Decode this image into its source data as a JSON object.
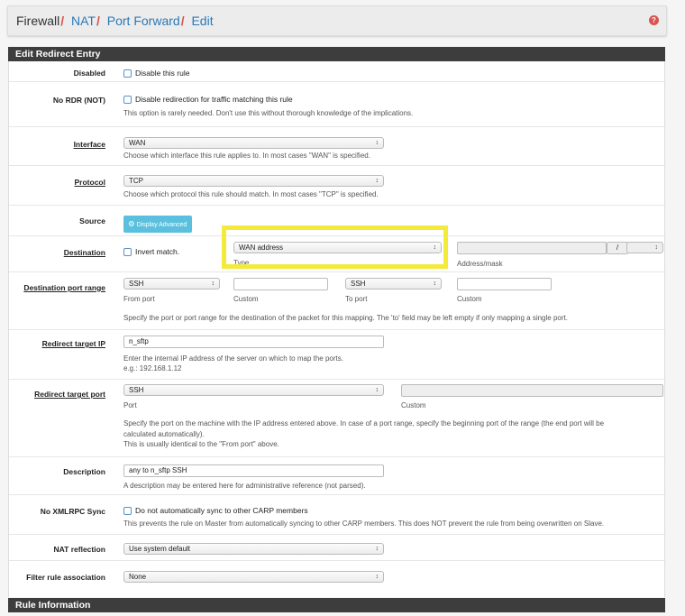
{
  "breadcrumb": {
    "root": "Firewall",
    "items": [
      "NAT",
      "Port Forward",
      "Edit"
    ],
    "separator": "/"
  },
  "help_icon": "question-icon",
  "panels": {
    "edit_title": "Edit Redirect Entry",
    "rule_info_title": "Rule Information"
  },
  "disabled": {
    "label": "Disabled",
    "checkbox_label": "Disable this rule"
  },
  "no_rdr": {
    "label": "No RDR (NOT)",
    "checkbox_label": "Disable redirection for traffic matching this rule",
    "help": "This option is rarely needed. Don't use this without thorough knowledge of the implications."
  },
  "interface": {
    "label": "Interface",
    "value": "WAN",
    "help": "Choose which interface this rule applies to. In most cases \"WAN\" is specified."
  },
  "protocol": {
    "label": "Protocol",
    "value": "TCP",
    "help": "Choose which protocol this rule should match. In most cases \"TCP\" is specified."
  },
  "source": {
    "label": "Source",
    "button": "Display Advanced"
  },
  "destination": {
    "label": "Destination",
    "invert_label": "Invert match.",
    "type_value": "WAN address",
    "type_caption": "Type",
    "address_caption": "Address/mask",
    "slash": "/"
  },
  "dest_port_range": {
    "label": "Destination port range",
    "from_value": "SSH",
    "from_caption": "From port",
    "custom_caption": "Custom",
    "to_value": "SSH",
    "to_caption": "To port",
    "custom2_caption": "Custom",
    "help": "Specify the port or port range for the destination of the packet for this mapping. The 'to' field may be left empty if only mapping a single port."
  },
  "redirect_ip": {
    "label": "Redirect target IP",
    "value": "n_sftp",
    "help1": "Enter the internal IP address of the server on which to map the ports.",
    "help2": "e.g.: 192.168.1.12"
  },
  "redirect_port": {
    "label": "Redirect target port",
    "value": "SSH",
    "port_caption": "Port",
    "custom_caption": "Custom",
    "help1": "Specify the port on the machine with the IP address entered above. In case of a port range, specify the beginning port of the range (the end port will be",
    "help2": "calculated automatically).",
    "help3": "This is usually identical to the \"From port\" above."
  },
  "description": {
    "label": "Description",
    "value": "any to n_sftp SSH",
    "help": "A description may be entered here for administrative reference (not parsed)."
  },
  "no_xmlrpc": {
    "label": "No XMLRPC Sync",
    "checkbox_label": "Do not automatically sync to other CARP members",
    "help": "This prevents the rule on Master from automatically syncing to other CARP members. This does NOT prevent the rule from being overwritten on Slave."
  },
  "nat_reflection": {
    "label": "NAT reflection",
    "value": "Use system default"
  },
  "filter_assoc": {
    "label": "Filter rule association",
    "value": "None"
  },
  "select_arrows": "↕",
  "colors": {
    "link": "#2a79b7",
    "separator": "#d9534f",
    "panel_heading": "#3d3d3d",
    "button_info": "#5bc0de",
    "highlight": "#f4ea3a"
  }
}
